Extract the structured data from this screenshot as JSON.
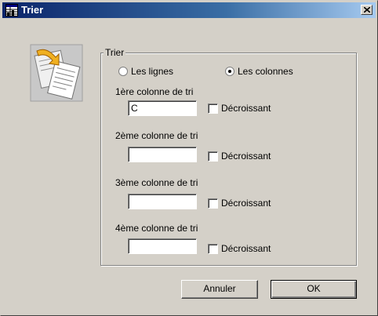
{
  "window": {
    "title": "Trier"
  },
  "group": {
    "legend": "Trier",
    "orientation": {
      "options": [
        "Les lignes",
        "Les colonnes"
      ],
      "selected": "Les colonnes"
    },
    "sort_columns": [
      {
        "label": "1ère colonne de tri",
        "value": "C",
        "descending_label": "Décroissant",
        "descending": false
      },
      {
        "label": "2ème colonne de tri",
        "value": "",
        "descending_label": "Décroissant",
        "descending": false
      },
      {
        "label": "3ème colonne de tri",
        "value": "",
        "descending_label": "Décroissant",
        "descending": false
      },
      {
        "label": "4ème colonne de tri",
        "value": "",
        "descending_label": "Décroissant",
        "descending": false
      }
    ]
  },
  "buttons": {
    "cancel": "Annuler",
    "ok": "OK"
  },
  "icons": {
    "app": "spreadsheet-icon",
    "close": "close-icon",
    "illustration": "sort-documents-icon"
  }
}
